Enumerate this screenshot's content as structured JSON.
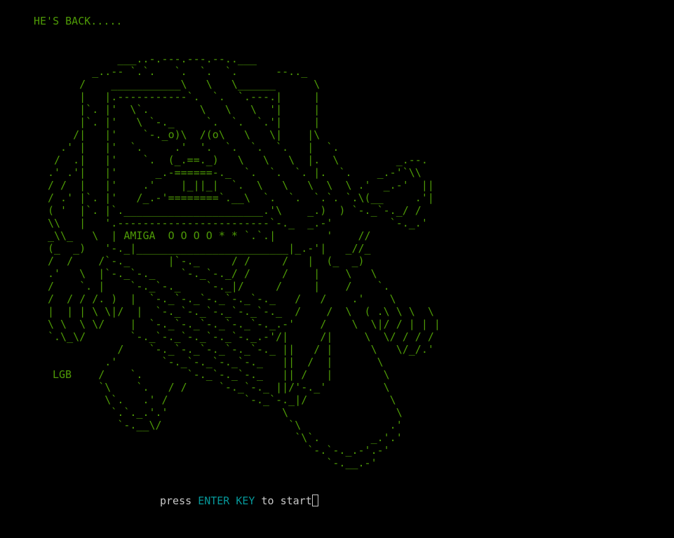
{
  "colors": {
    "background": "#000000",
    "art_green": "#4e9a06",
    "prompt_gray": "#c8c8c8",
    "prompt_cyan": "#06989a"
  },
  "headline": "HE'S BACK.....",
  "signature": "LGB",
  "ascii_art": "           ___..-.---.---.--..___\n       _..-- `.`.   `.  `.  `.      --.._\n     /    ___________\\   \\   \\______      \\\n     |   |.-----------`.  `.  `.---.|     |\n     |`. |'  \\`.        \\   \\   \\  '|     |\n     |`. |'   \\ `-._     `.  `.  `.'|     |\n    /|   |'    `-._o)\\  /(o\\   \\   \\|    |\\\n  .' |   |'  `.     .'  '.  `.  `.  `.   |  `.\n /  .|   |'    `.  (_.==._)   \\   \\   \\  |.  \\         _.--.\n.' .'|   |'      _.-======-._  `.  `.  `. |.  `.    _.-'`\\\\\n/ /  |   |'    .'    |_||_|  `.  \\   \\   \\  \\  \\ .'  _.-'  ||\n/ .' |`. |'   /_.-'========`.__\\  `.  `.  `.`. `.\\(__     .'|\n( '  |`. |`.______________________.'\\    _.)  ) `-._`-._/ /\n\\\\   |   '.------------------------`-._  _.-'         `-._.'\n_\\\\_   \\  | AMIGA  O O O O * * `.`.|        '    //\n(_  _)   '-._|________________________|_.-'|   _//_\n/  /    /`-._      |`-._     / /     /   |  (_  _)\n.'   \\  |`-._`-._    `-._`-._/ /     /    |    \\   \\\n/    `. |    `-._`-._    `-._|/     /     |    /    `.\n/  / / /. )  |  `-._`-._`-._`-._`-._   /   /    .'    \\\n|  | | \\ \\|/  |  `-._`-._`-._`-._`-._  /    /  \\  ( .\\ \\ \\  \\\n\\ \\  \\ \\/    |  `-._`-._`-._`-._`-._.-'    /    \\  \\|/ / | | |\n`.\\_\\/       `-._`-._`-._`-._`-._.-'/|     /|     \\  \\/ / / /\n           /    `-._`-._`-._`-._`-._ ||   / |      \\   \\/_/.'\n         .'       `-._`-._`-._`-._   ||  /  |       \\\n        /    `.       `-._`-._`-._   || /   |        \\\n        `\\    `.   / /     `-._`-._ ||/'-._'         \\\n         \\`.   .' /            `-._`-._|/             \\\n          `.`._.'.'                  \\                 \\\n           `-.__\\/                    `\\              .'\n                                       `\\`.        _.'.'\n                                         `-.`-._.-'.-'\n                                            `-.__.-'",
  "prompt": {
    "before": "press ",
    "key": "ENTER KEY",
    "after": " to start"
  }
}
